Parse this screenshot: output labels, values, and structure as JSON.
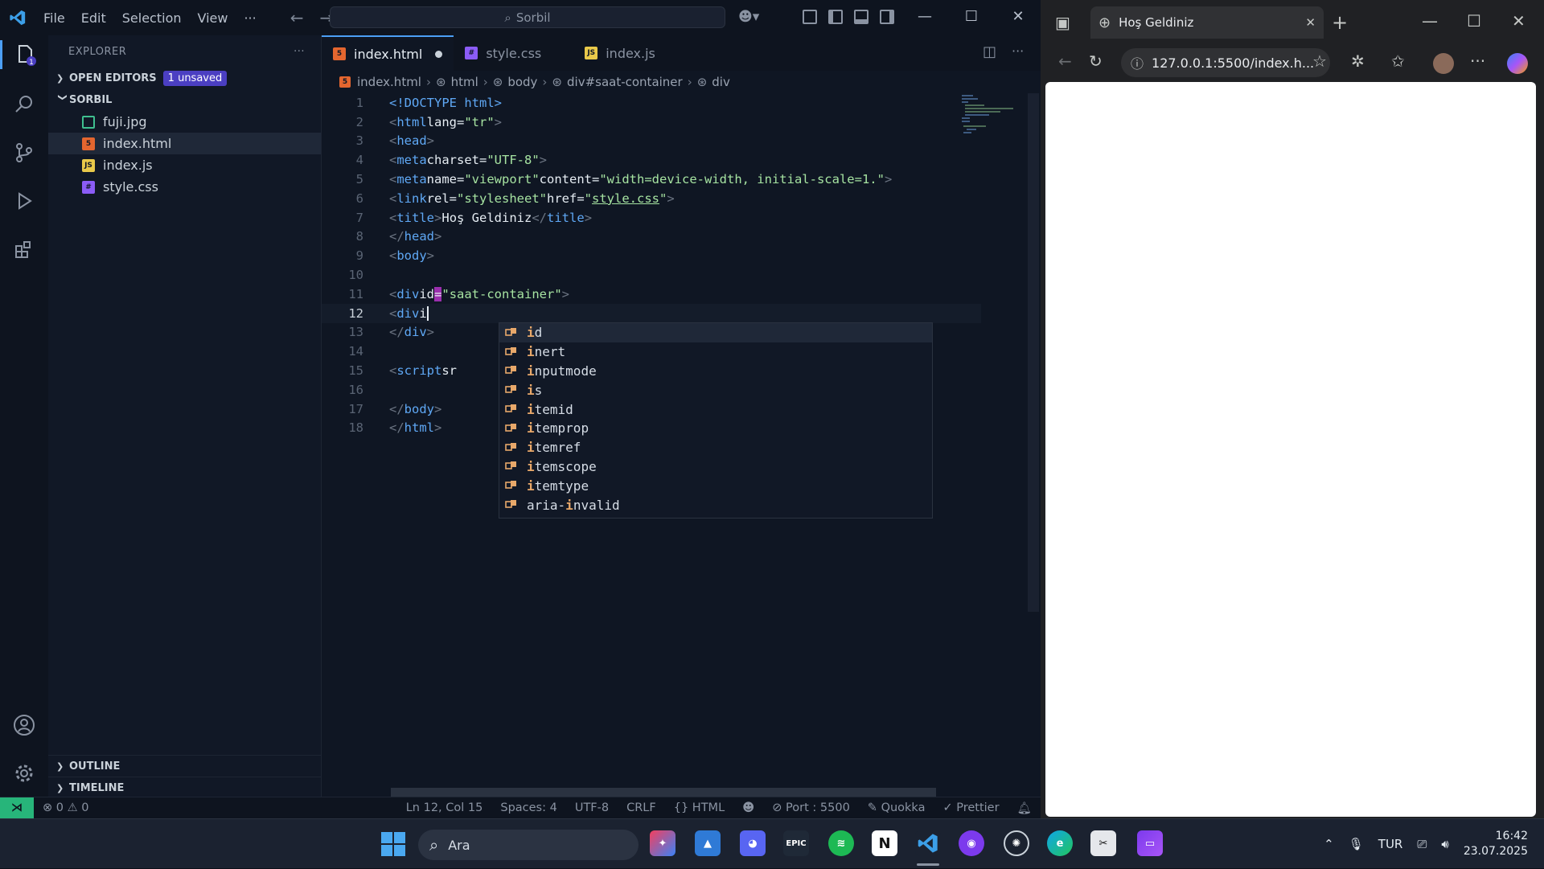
{
  "vscode": {
    "menu": [
      "File",
      "Edit",
      "Selection",
      "View",
      "···"
    ],
    "command_center": "Sorbil",
    "explorer": {
      "header": "EXPLORER",
      "open_editors": "OPEN EDITORS",
      "unsaved_badge": "1 unsaved",
      "project": "SORBIL",
      "files": [
        "fuji.jpg",
        "index.html",
        "index.js",
        "style.css"
      ],
      "outline": "OUTLINE",
      "timeline": "TIMELINE"
    },
    "tabs": [
      "index.html",
      "style.css",
      "index.js"
    ],
    "breadcrumb": [
      "index.html",
      "html",
      "body",
      "div#saat-container",
      "div"
    ],
    "line_numbers": [
      "1",
      "2",
      "3",
      "4",
      "5",
      "6",
      "7",
      "8",
      "9",
      "10",
      "11",
      "12",
      "13",
      "14",
      "15",
      "16",
      "17",
      "18"
    ],
    "code": {
      "l1": "<!DOCTYPE html>",
      "l2_tag": "html",
      "l2_attr": "lang",
      "l2_val": "\"tr\"",
      "l3": "head",
      "l4_tag": "meta",
      "l4_attr": "charset",
      "l4_val": "\"UTF-8\"",
      "l5_tag": "meta",
      "l5_attr1": "name",
      "l5_val1": "\"viewport\"",
      "l5_attr2": "content",
      "l5_val2": "\"width=device-width, initial-scale=1.\"",
      "l6_tag": "link",
      "l6_attr1": "rel",
      "l6_val1": "\"stylesheet\"",
      "l6_attr2": "href",
      "l6_val2": "style.css",
      "l7_tag": "title",
      "l7_text": "Hoş Geldiniz",
      "l8": "head",
      "l9": "body",
      "l11_tag": "div",
      "l11_attr": "id",
      "l11_val": "\"saat-container\"",
      "l12_tag": "div",
      "l12_typed": "i",
      "l13": "div",
      "l15_tag": "script",
      "l15_partial": "sr",
      "l17": "body",
      "l18": "html"
    },
    "suggestions": [
      {
        "bold": "i",
        "rest": "d"
      },
      {
        "bold": "i",
        "rest": "nert"
      },
      {
        "bold": "i",
        "rest": "nputmode"
      },
      {
        "bold": "i",
        "rest": "s"
      },
      {
        "bold": "i",
        "rest": "temid"
      },
      {
        "bold": "i",
        "rest": "temprop"
      },
      {
        "bold": "i",
        "rest": "temref"
      },
      {
        "bold": "i",
        "rest": "temscope"
      },
      {
        "bold": "i",
        "rest": "temtype"
      },
      {
        "pre": "aria-",
        "bold": "i",
        "rest": "nvalid"
      }
    ],
    "status": {
      "problems": "0",
      "warnings": "0",
      "position": "Ln 12, Col 15",
      "spaces": "Spaces: 4",
      "encoding": "UTF-8",
      "eol": "CRLF",
      "language": "HTML",
      "port": "Port : 5500",
      "quokka": "Quokka",
      "prettier": "Prettier"
    }
  },
  "browser": {
    "tab_title": "Hoş Geldiniz",
    "url": "127.0.0.1:5500/index.h..."
  },
  "taskbar": {
    "search_label": "Ara",
    "language": "TUR",
    "time": "16:42",
    "date": "23.07.2025"
  },
  "colors": {
    "accent": "#4c9ff5",
    "remote": "#27b57a",
    "badge": "#4b3fc2"
  }
}
